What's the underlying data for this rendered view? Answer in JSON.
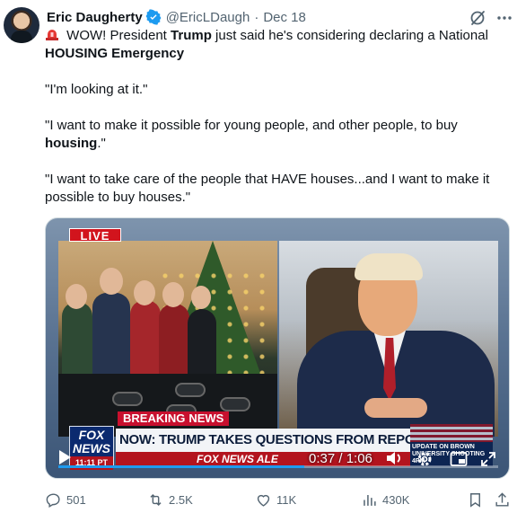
{
  "author": {
    "name": "Eric Daugherty",
    "handle": "@EricLDaugh",
    "separator": "·",
    "date": "Dec 18",
    "verified": true
  },
  "tweet": {
    "line1_prefix": " WOW! President ",
    "line1_bold": "Trump",
    "line1_suffix": " just said he's considering declaring a National ",
    "line1_bold2": "HOUSING Emergency",
    "quote1": "\"I'm looking at it.\"",
    "quote2_prefix": "\"I want to make it possible for young people, and other people, to buy ",
    "quote2_bold": "housing",
    "quote2_suffix": ".\"",
    "quote3": "\"I want to take care of the people that HAVE houses...and I want to make it possible to buy houses.\""
  },
  "video": {
    "live_badge": "LIVE",
    "breaking_part1": "BREAKING",
    "breaking_part2": "NEWS",
    "channel_logo_line1": "FOX",
    "channel_logo_line2": "NEWS",
    "channel_time": "11:11 PT",
    "headline": "NOW: TRUMP TAKES QUESTIONS FROM REPORTERS AT WH",
    "ticker": "FOX NEWS ALE",
    "side_promo": "UPDATE ON BROWN UNIVERSITY SHOOTING 4PM",
    "time_readout": "0:37 / 1:06",
    "progress_fraction": 0.56
  },
  "actions": {
    "replies": "501",
    "reposts": "2.5K",
    "likes": "11K",
    "views": "430K"
  },
  "colors": {
    "verified": "#1d9bf0",
    "muted_text": "#536471",
    "live_red": "#d2141d",
    "progress": "#1d9bf0"
  },
  "icons": [
    "verified-badge-icon",
    "grok-icon",
    "more-icon",
    "siren-icon",
    "play-icon",
    "volume-icon",
    "settings-gear-icon",
    "picture-in-picture-icon",
    "fullscreen-icon",
    "reply-icon",
    "repost-icon",
    "like-icon",
    "views-icon",
    "bookmark-icon",
    "share-icon"
  ]
}
